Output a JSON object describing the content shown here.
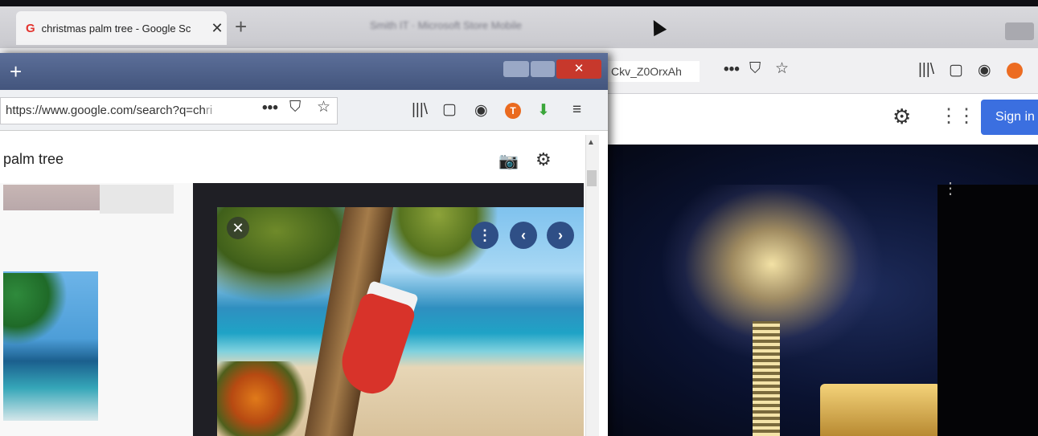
{
  "back_window": {
    "tab_title": "christmas palm tree - Google Sc",
    "tab_favicon": "G",
    "tab_close": "✕",
    "new_tab": "+",
    "blurred_title": "Smith IT · Microsoft Store Mobile",
    "url_fragment": "Ckv_Z0OrxAh",
    "sign_in": "Sign in",
    "accent": "#3b6fe0"
  },
  "front_window": {
    "new_tab": "+",
    "close_glyph": "✕",
    "url": "https://www.google.com/search?q=ch",
    "url_faded": "ri",
    "search_query": "palm tree",
    "preview_close": "✕"
  },
  "icons": {
    "more": "•••",
    "pocket": "⛉",
    "star": "☆",
    "library": "|||\\",
    "sidebar": "▢",
    "account": "◉",
    "download": "⬇",
    "menu": "≡",
    "camera": "📷",
    "gear": "⚙",
    "apps": "⋮⋮⋮",
    "kebab": "⋮",
    "prev": "‹",
    "next": "›",
    "scroll_up": "▲",
    "ext_letter": "T"
  }
}
